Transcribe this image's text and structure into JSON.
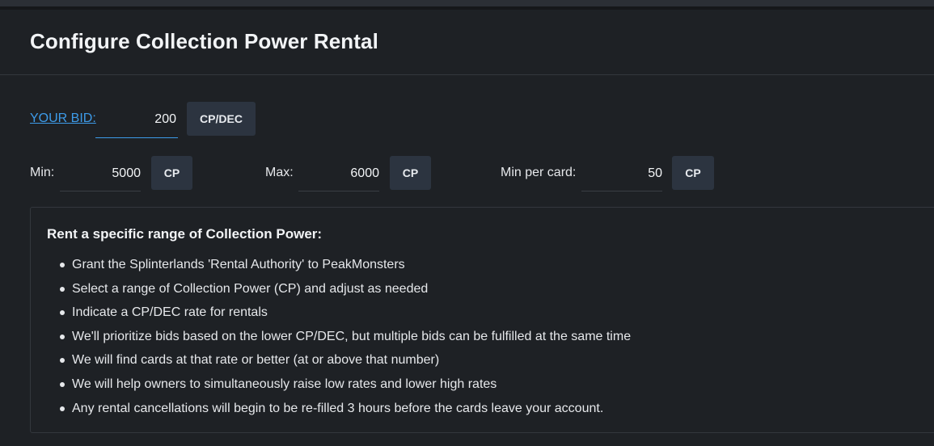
{
  "page": {
    "title": "Configure Collection Power Rental"
  },
  "bid": {
    "label": "YOUR BID:",
    "value": "200",
    "unit": "CP/DEC"
  },
  "fields": {
    "min": {
      "label": "Min:",
      "value": "5000",
      "unit": "CP"
    },
    "max": {
      "label": "Max:",
      "value": "6000",
      "unit": "CP"
    },
    "min_per_card": {
      "label": "Min per card:",
      "value": "50",
      "unit": "CP"
    }
  },
  "info": {
    "title": "Rent a specific range of Collection Power:",
    "items": [
      "Grant the Splinterlands 'Rental Authority' to PeakMonsters",
      "Select a range of Collection Power (CP) and adjust as needed",
      "Indicate a CP/DEC rate for rentals",
      "We'll prioritize bids based on the lower CP/DEC, but multiple bids can be fulfilled at the same time",
      "We will find cards at that rate or better (at or above that number)",
      "We will help owners to simultaneously raise low rates and lower high rates",
      "Any rental cancellations will begin to be re-filled 3 hours before the cards leave your account."
    ]
  },
  "colors": {
    "background": "#1e2125",
    "accent": "#3d9be9",
    "button": "#2c3440"
  }
}
